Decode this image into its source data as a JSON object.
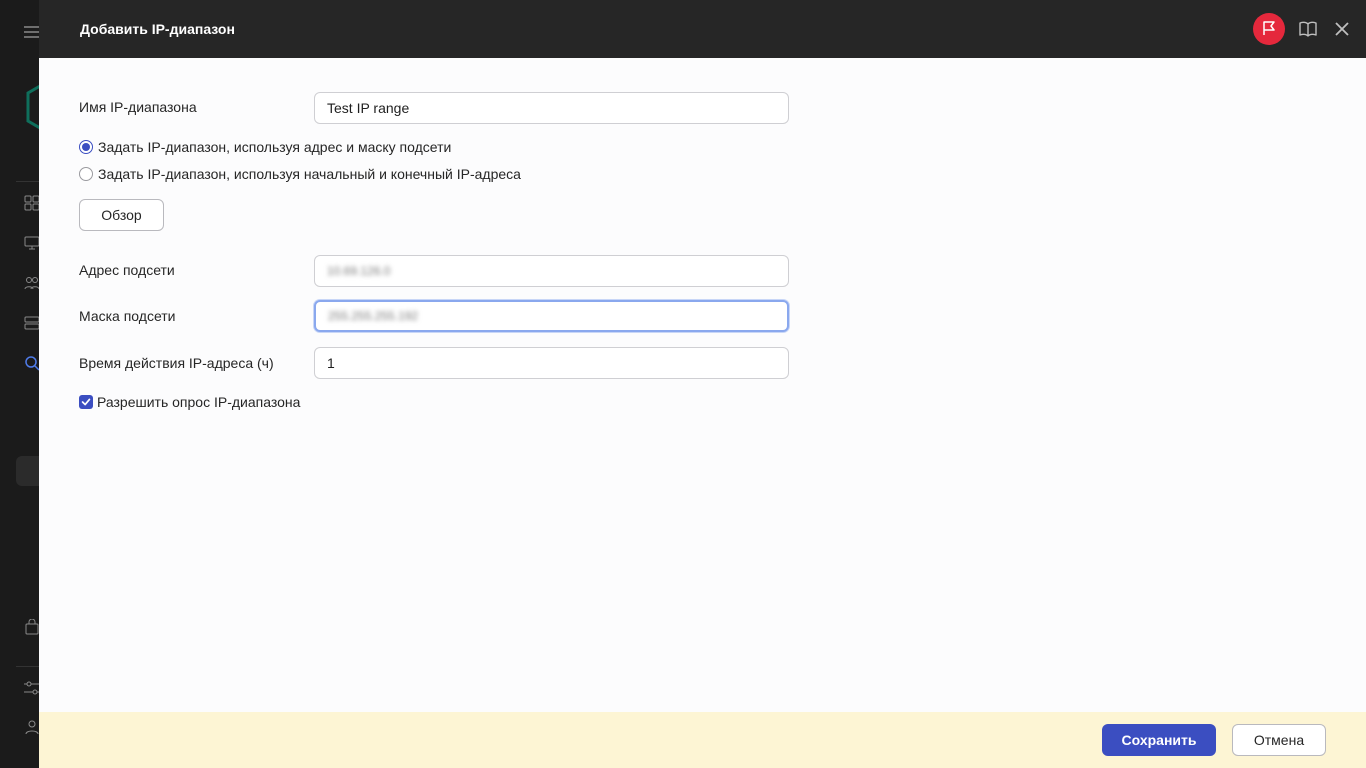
{
  "dialog": {
    "title": "Добавить IP-диапазон"
  },
  "form": {
    "name_label": "Имя IP-диапазона",
    "name_value": "Test IP range",
    "radio_subnet_label": "Задать IP-диапазон, используя адрес и маску подсети",
    "radio_subnet_checked": true,
    "radio_range_label": "Задать IP-диапазон, используя начальный и конечный IP-адреса",
    "radio_range_checked": false,
    "browse_button_label": "Обзор",
    "subnet_address_label": "Адрес подсети",
    "subnet_address_value": "10.69.126.0",
    "subnet_mask_label": "Маска подсети",
    "subnet_mask_value": "255.255.255.192",
    "lease_time_label": "Время действия IP-адреса (ч)",
    "lease_time_value": "1",
    "allow_polling_label": "Разрешить опрос IP-диапазона",
    "allow_polling_checked": true
  },
  "footer": {
    "save_label": "Сохранить",
    "cancel_label": "Отмена"
  },
  "colors": {
    "accent": "#3b4ec1",
    "header_bg": "#262626",
    "flag_button": "#e5283c",
    "footer_bg": "#fdf5d4"
  },
  "icons": {
    "header": [
      "flag-icon",
      "book-icon",
      "close-icon"
    ],
    "sidebar": [
      "menu-icon",
      "logo-icon",
      "dashboard-icon",
      "monitor-icon",
      "users-icon",
      "server-icon",
      "search-icon",
      "bag-icon",
      "sliders-icon",
      "user-icon"
    ]
  }
}
